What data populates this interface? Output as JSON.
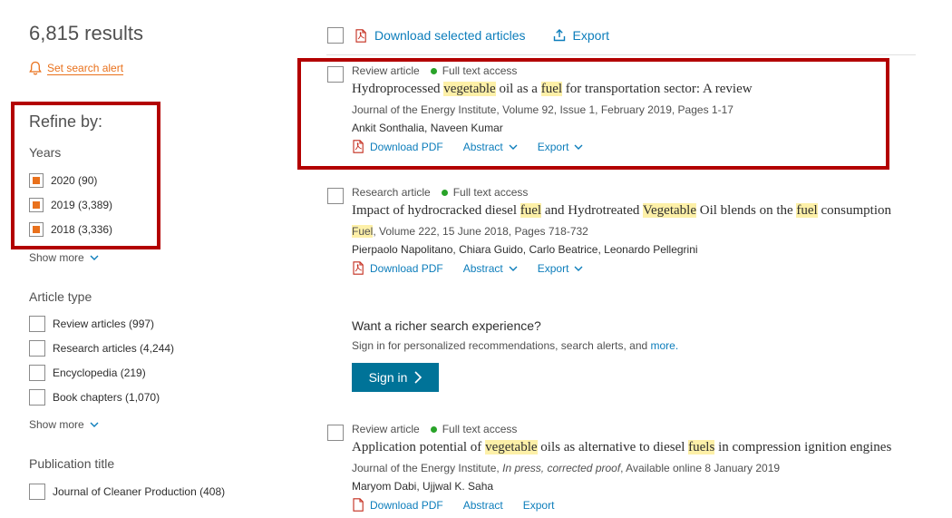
{
  "search": {
    "results_count": "6,815 results",
    "alert_label": "Set search alert"
  },
  "refine": {
    "title": "Refine by:",
    "years": {
      "heading": "Years",
      "items": [
        {
          "label": "2020 (90)",
          "checked": true
        },
        {
          "label": "2019 (3,389)",
          "checked": true
        },
        {
          "label": "2018 (3,336)",
          "checked": true
        }
      ],
      "show_more": "Show more"
    },
    "article_type": {
      "heading": "Article type",
      "items": [
        {
          "label": "Review articles (997)",
          "checked": false
        },
        {
          "label": "Research articles (4,244)",
          "checked": false
        },
        {
          "label": "Encyclopedia (219)",
          "checked": false
        },
        {
          "label": "Book chapters (1,070)",
          "checked": false
        }
      ],
      "show_more": "Show more"
    },
    "publication_title": {
      "heading": "Publication title",
      "items": [
        {
          "label": "Journal of Cleaner Production (408)",
          "checked": false
        }
      ]
    }
  },
  "toolbar": {
    "download_label": "Download selected articles",
    "export_label": "Export"
  },
  "articles": [
    {
      "type": "Review article",
      "access": "Full text access",
      "title_parts": [
        "Hydroprocessed ",
        "vegetable",
        " oil as a ",
        "fuel",
        " for transportation sector: A review"
      ],
      "source": "Journal of the Energy Institute, Volume 92, Issue 1, February 2019, Pages 1-17",
      "authors": "Ankit Sonthalia, Naveen Kumar",
      "download_pdf": "Download PDF",
      "abstract": "Abstract",
      "export": "Export"
    },
    {
      "type": "Research article",
      "access": "Full text access",
      "title_parts": [
        "Impact of hydrocracked diesel ",
        "fuel",
        " and Hydrotreated ",
        "Vegetable",
        " Oil blends on the ",
        "fuel",
        " consumption"
      ],
      "source_hl": "Fuel",
      "source": ", Volume 222, 15 June 2018, Pages 718-732",
      "authors": "Pierpaolo Napolitano, Chiara Guido, Carlo Beatrice, Leonardo Pellegrini",
      "download_pdf": "Download PDF",
      "abstract": "Abstract",
      "export": "Export"
    },
    {
      "type": "Review article",
      "access": "Full text access",
      "title_parts": [
        "Application potential of ",
        "vegetable",
        " oils as alternative to diesel ",
        "fuels",
        " in compression ignition engines"
      ],
      "source_a": "Journal of the Energy Institute, ",
      "source_b": "In press, corrected proof",
      "source_c": ", Available online 8 January 2019",
      "authors": "Maryom Dabi, Ujjwal K. Saha",
      "download_pdf": "Download PDF",
      "abstract": "Abstract",
      "export": "Export"
    }
  ],
  "promo": {
    "title": "Want a richer search experience?",
    "text": "Sign in for personalized recommendations, search alerts, and ",
    "more_link": "more.",
    "signin_label": "Sign in"
  },
  "colors": {
    "accent_orange": "#e9711c",
    "link_blue": "#0c7dbb",
    "signin_blue": "#007398",
    "highlight_box_red": "#b30000",
    "term_highlight": "#fdf0a8",
    "access_green": "#29a329"
  },
  "icons": [
    "bell-icon",
    "pdf-icon",
    "export-icon",
    "chevron-down-icon",
    "chevron-right-icon"
  ]
}
